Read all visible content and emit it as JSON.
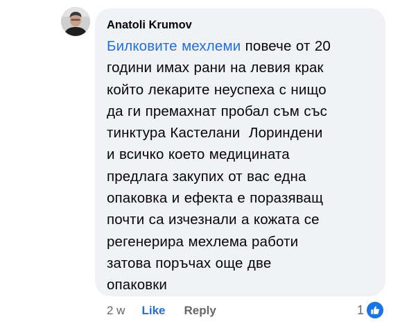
{
  "comment": {
    "author": "Anatoli Krumov",
    "tag": "Билковите мехлеми",
    "line1_rest": " повече от 20",
    "lines": [
      "години имах рани на левия крак",
      "който лекарите неуспеха с нищо",
      "да ги премахнат пробал съм със",
      "тинктура Кастелани  Лориндени",
      "и всичко което медицината",
      "предлага закупих от вас една",
      "опаковка и ефекта е поразяващ",
      "почти са изчезнали а кожата се",
      "регенерира мехлема работи",
      "затова поръчах още две",
      "опаковки"
    ]
  },
  "actions": {
    "time": "2 w",
    "like": "Like",
    "reply": "Reply"
  },
  "reactions": {
    "count": "1",
    "icon": "thumbs-up-icon",
    "color": "#1b74e4"
  },
  "colors": {
    "bubble": "#f0f2f5",
    "tag": "#216fdb",
    "meta": "#65676b"
  }
}
